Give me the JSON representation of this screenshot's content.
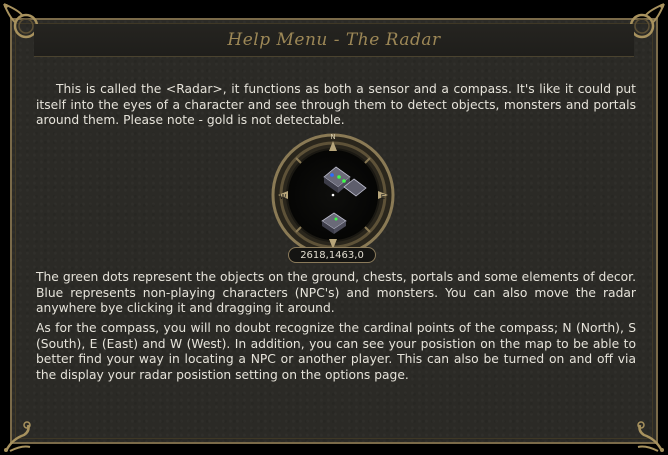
{
  "window": {
    "title": "Help Menu - The Radar"
  },
  "content": {
    "paragraph1": "This is called the <Radar>, it functions as both a sensor and a compass. It's like it could put itself into the eyes of a character and see through them to detect objects, monsters and portals around them. Please note - gold is not detectable.",
    "paragraph2": "The green dots represent the objects on the ground, chests, portals and some elements of decor.  Blue represents non-playing characters (NPC's) and monsters.  You can also move the radar anywhere bye clicking it and dragging it around.",
    "paragraph3": "As for the compass, you will no doubt recognize the cardinal points of the compass; N (North), S (South), E (East) and W (West).  In addition, you can see your posistion on the map to be able to better find your way in locating a NPC or another player.  This can also be turned on and off via the display your radar posistion setting on the options page."
  },
  "radar": {
    "north": "N",
    "south": "S",
    "east": "E",
    "west": "W",
    "coordinates": "2618,1463,0",
    "dot_colors": {
      "objects": "#3cff4a",
      "npc_monsters": "#2a6cff"
    }
  },
  "theme": {
    "frame_gold": "#7a6a49",
    "title_gold": "#9c8756",
    "panel_bg": "#2b2a26"
  }
}
